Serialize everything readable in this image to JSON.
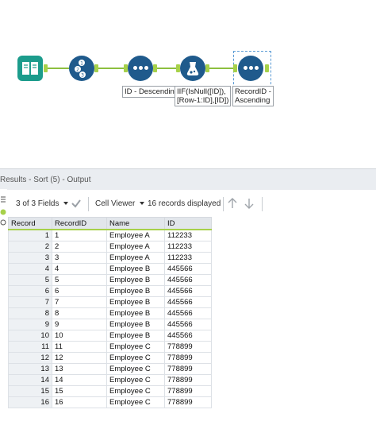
{
  "canvas": {
    "labels": {
      "sort1": "ID - Descending",
      "formula": [
        "IIF(IsNull([ID]),",
        "[Row-1:ID],[ID])"
      ],
      "sort2": [
        "RecordID -",
        "Ascending"
      ]
    },
    "record_id_digits": [
      "1",
      "2",
      "3"
    ],
    "colors": {
      "accent": "#a7d14a",
      "tool_blue": "#1f5a8c",
      "input_teal": "#1c9c8c"
    }
  },
  "results": {
    "header": "Results - Sort (5) - Output",
    "toolbar": {
      "fields": "3 of 3 Fields",
      "viewer": "Cell Viewer",
      "records": "16 records displayed"
    },
    "columns": [
      "Record",
      "RecordID",
      "Name",
      "ID"
    ],
    "rows": [
      [
        "1",
        "1",
        "Employee A",
        "112233"
      ],
      [
        "2",
        "2",
        "Employee A",
        "112233"
      ],
      [
        "3",
        "3",
        "Employee A",
        "112233"
      ],
      [
        "4",
        "4",
        "Employee B",
        "445566"
      ],
      [
        "5",
        "5",
        "Employee B",
        "445566"
      ],
      [
        "6",
        "6",
        "Employee B",
        "445566"
      ],
      [
        "7",
        "7",
        "Employee B",
        "445566"
      ],
      [
        "8",
        "8",
        "Employee B",
        "445566"
      ],
      [
        "9",
        "9",
        "Employee B",
        "445566"
      ],
      [
        "10",
        "10",
        "Employee B",
        "445566"
      ],
      [
        "11",
        "11",
        "Employee C",
        "778899"
      ],
      [
        "12",
        "12",
        "Employee C",
        "778899"
      ],
      [
        "13",
        "13",
        "Employee C",
        "778899"
      ],
      [
        "14",
        "14",
        "Employee C",
        "778899"
      ],
      [
        "15",
        "15",
        "Employee C",
        "778899"
      ],
      [
        "16",
        "16",
        "Employee C",
        "778899"
      ]
    ]
  }
}
